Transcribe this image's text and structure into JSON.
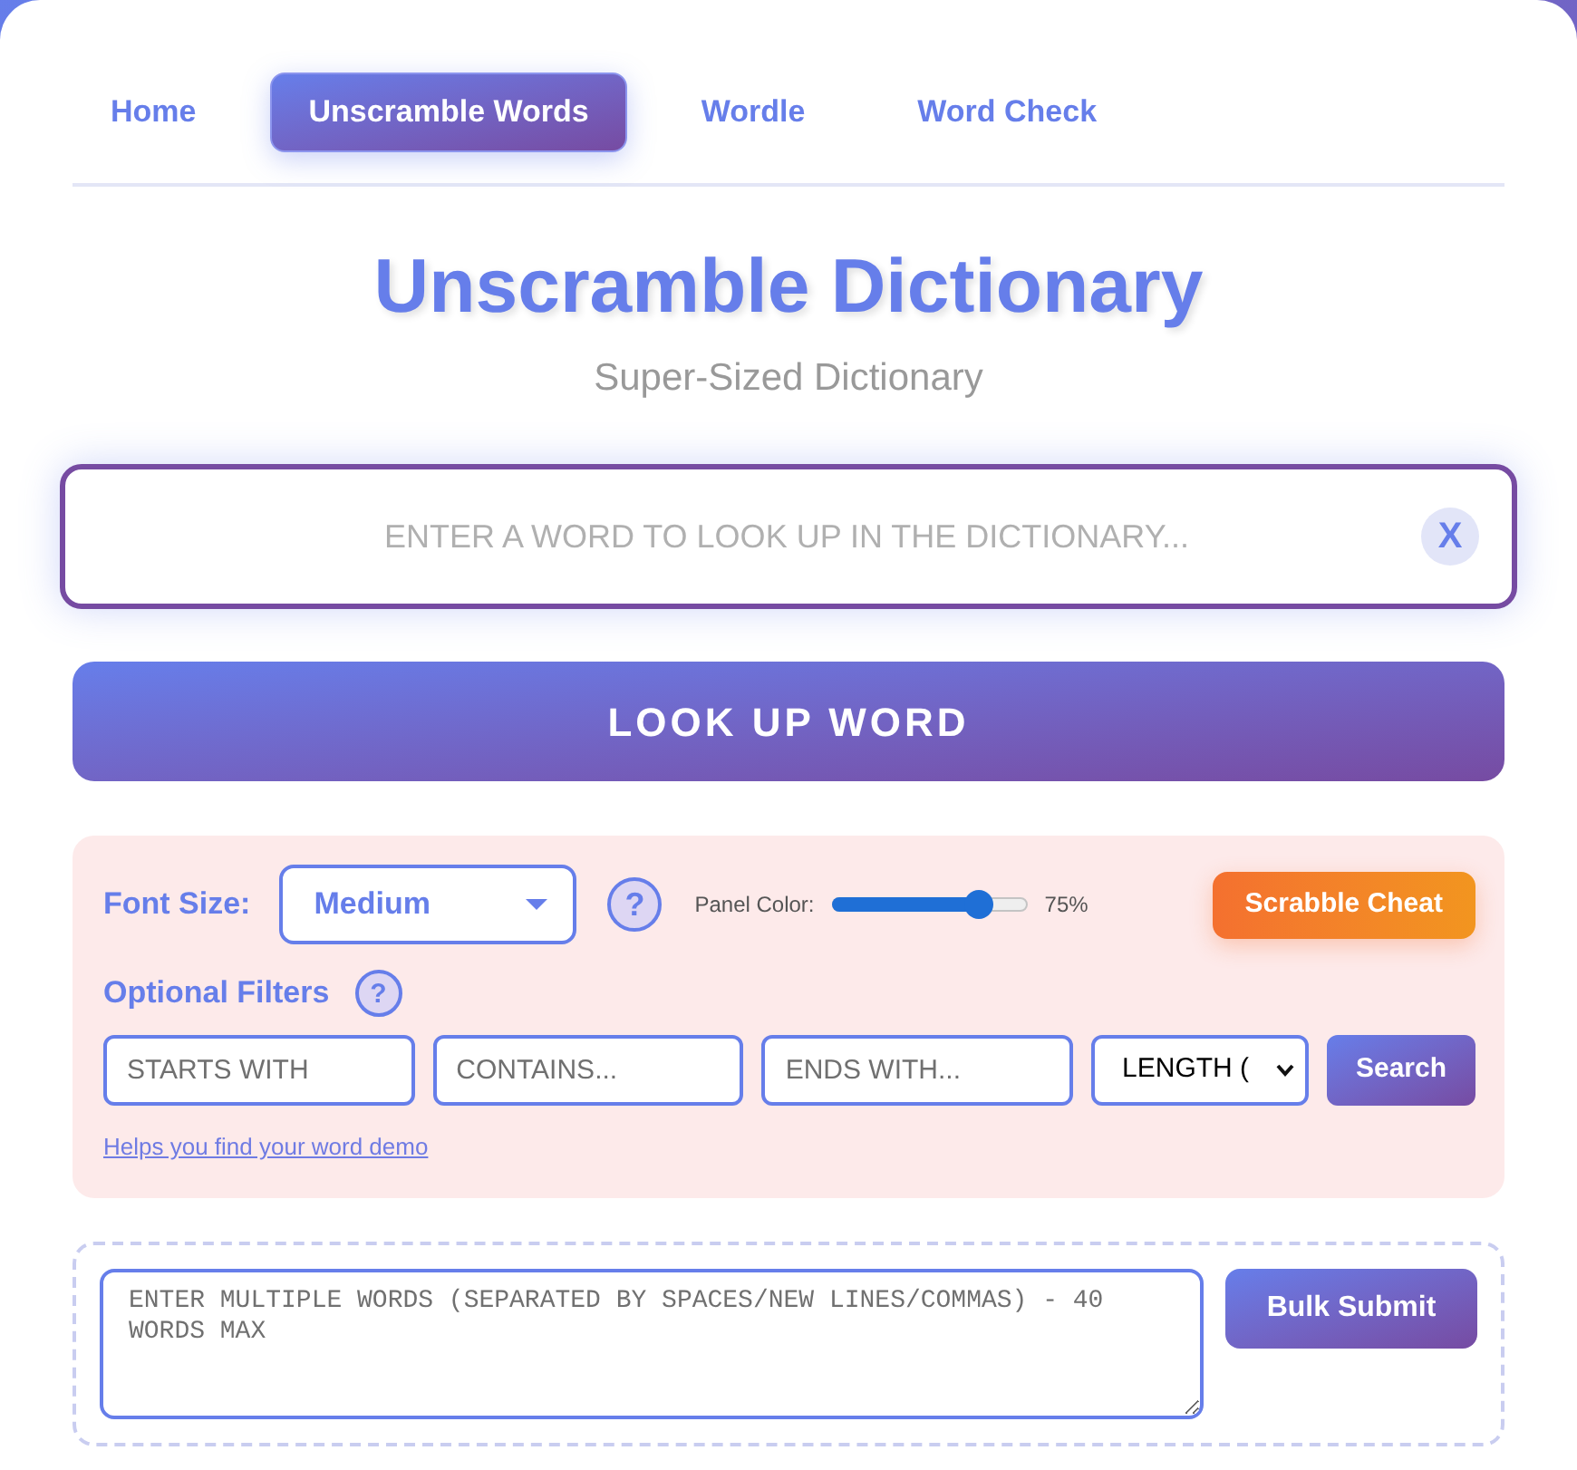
{
  "nav": {
    "tabs": [
      {
        "label": "Home",
        "selected": false
      },
      {
        "label": "Unscramble Words",
        "selected": true
      },
      {
        "label": "Wordle",
        "selected": false
      },
      {
        "label": "Word Check",
        "selected": false
      }
    ]
  },
  "header": {
    "title": "Unscramble Dictionary",
    "subtitle": "Super-Sized Dictionary"
  },
  "lookup": {
    "placeholder": "ENTER A WORD TO LOOK UP IN THE DICTIONARY...",
    "clear_button": "X",
    "submit_button": "LOOK UP WORD"
  },
  "options": {
    "font_size": {
      "label": "Font Size:",
      "value": "Medium",
      "help": "?"
    },
    "panel_color": {
      "label": "Panel Color:",
      "level": 0.75,
      "reading": "75%"
    },
    "scrabble_button": "Scrabble Cheat",
    "filters": {
      "label": "Optional Filters",
      "help": "?",
      "fields": [
        {
          "placeholder": "STARTS WITH"
        },
        {
          "placeholder": "CONTAINS..."
        },
        {
          "placeholder": "ENDS WITH..."
        }
      ],
      "length_select": "LENGTH (",
      "search_button": "Search"
    },
    "demo_link": "Helps you find your word demo"
  },
  "bulk": {
    "placeholder": "ENTER MULTIPLE WORDS (SEPARATED BY SPACES/NEW LINES/COMMAS) - 40 WORDS MAX",
    "submit_button": "Bulk Submit"
  }
}
